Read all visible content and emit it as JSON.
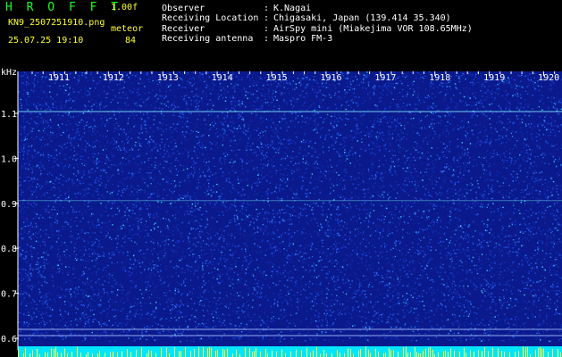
{
  "header": {
    "app_title": "H R O F F T",
    "app_version": "1.00f",
    "filename": "KN9_2507251910.png",
    "datetime": "25.07.25 19:10",
    "detection_label": "meteor",
    "detection_count": "84"
  },
  "info": [
    {
      "key": "Observer",
      "value": "K.Nagai"
    },
    {
      "key": "Receiving Location",
      "value": "Chigasaki, Japan (139.414 35.340)"
    },
    {
      "key": "Receiver",
      "value": "AirSpy mini (Miakejima VOR 108.65MHz)"
    },
    {
      "key": "Receiving antenna",
      "value": "Maspro FM-3"
    }
  ],
  "info_separator": ":",
  "waterfall": {
    "y_unit": "kHz",
    "time_labels": [
      "1911",
      "1912",
      "1913",
      "1914",
      "1915",
      "1916",
      "1917",
      "1918",
      "1919",
      "1920"
    ],
    "freq_labels": [
      "1.1",
      "1.0",
      "0.9",
      "0.8",
      "0.7",
      "0.6"
    ],
    "colors": {
      "background": "#0a1a8c",
      "noise_low": "#1c3fd0",
      "noise_high": "#3ad0ff",
      "carrier": "#7fe8ff",
      "bottom_band": "#00e5ff"
    }
  }
}
